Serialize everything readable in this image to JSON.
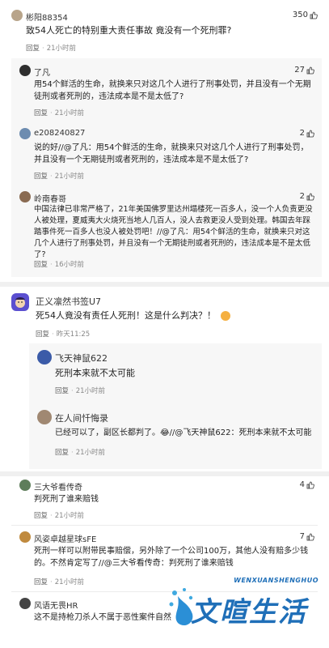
{
  "comments": [
    {
      "user": "彬阳88354",
      "likes": "350",
      "text": "致54人死亡的特别重大责任事故 竟没有一个死刑罪?",
      "reply": "回复",
      "time": "21小时前",
      "replies": [
        {
          "user": "了凡",
          "likes": "27",
          "text": "用54个鲜活的生命，就换来只对这几个人进行了刑事处罚，并且没有一个无期徒刑或者死刑的，违法成本是不是太低了?",
          "reply": "回复",
          "time": "21小时前"
        },
        {
          "user": "e208240827",
          "likes": "2",
          "text": "说的好//@了凡：用54个鲜活的生命，就换来只对这几个人进行了刑事处罚，并且没有一个无期徒刑或者死刑的，违法成本是不是太低了?",
          "reply": "回复",
          "time": "21小时前"
        },
        {
          "user": "岭南春哥",
          "likes": "2",
          "text": "中国法律已非常严格了，21年美国佛罗里达州塌楼死一百多人，没一个人负责更没人被处理，夏威夷大火烧死当地人几百人，没人去救更没人受到处理。韩国去年踩踏事件死一百多人也没人被处罚吧！//@了凡：用54个鲜活的生命，就换来只对这几个人进行了刑事处罚，并且没有一个无期徒刑或者死刑的，违法成本是不是太低了?",
          "reply": "回复",
          "time": "16小时前"
        }
      ]
    },
    {
      "user": "正义凛然书签U7",
      "likes": "",
      "text": "死54人竟没有责任人死刑！这是什么判决？！",
      "reply": "回复",
      "time": "昨天11:25",
      "replies": [
        {
          "user": "飞天神鼠622",
          "likes": "",
          "text": "死刑本来就不太可能",
          "reply": "回复",
          "time": "21小时前"
        },
        {
          "user": "在人间忏悔录",
          "likes": "",
          "text": "已经可以了，副区长都判了。😂//@飞天神鼠622：死刑本来就不太可能",
          "reply": "回复",
          "time": "21小时前"
        }
      ]
    },
    {
      "user": "三大爷看传奇",
      "likes": "4",
      "text": "判死刑了谁来赔钱",
      "reply": "回复",
      "time": "21小时前",
      "replies": [
        {
          "user": "风姿卓越星球sFE",
          "likes": "7",
          "text": "死刑一样可以附带民事赔偿，另外除了一个公司100万，其他人没有赔多少钱的。不然肯定写了//@三大爷看传奇：判死刑了谁来赔钱",
          "reply": "回复",
          "time": "21小时前"
        },
        {
          "user": "风语无畏HR",
          "likes": "",
          "text": "这不是持枪刀杀人不属于恶性案件自然",
          "reply": "",
          "time": ""
        }
      ]
    }
  ],
  "watermark": {
    "en": "WENXUANSHENGHUO",
    "cn": "文暄生活"
  },
  "colors": {
    "accent": "#1f6fb8",
    "meta": "#888888",
    "thread_bg": "#f7f7f7"
  }
}
